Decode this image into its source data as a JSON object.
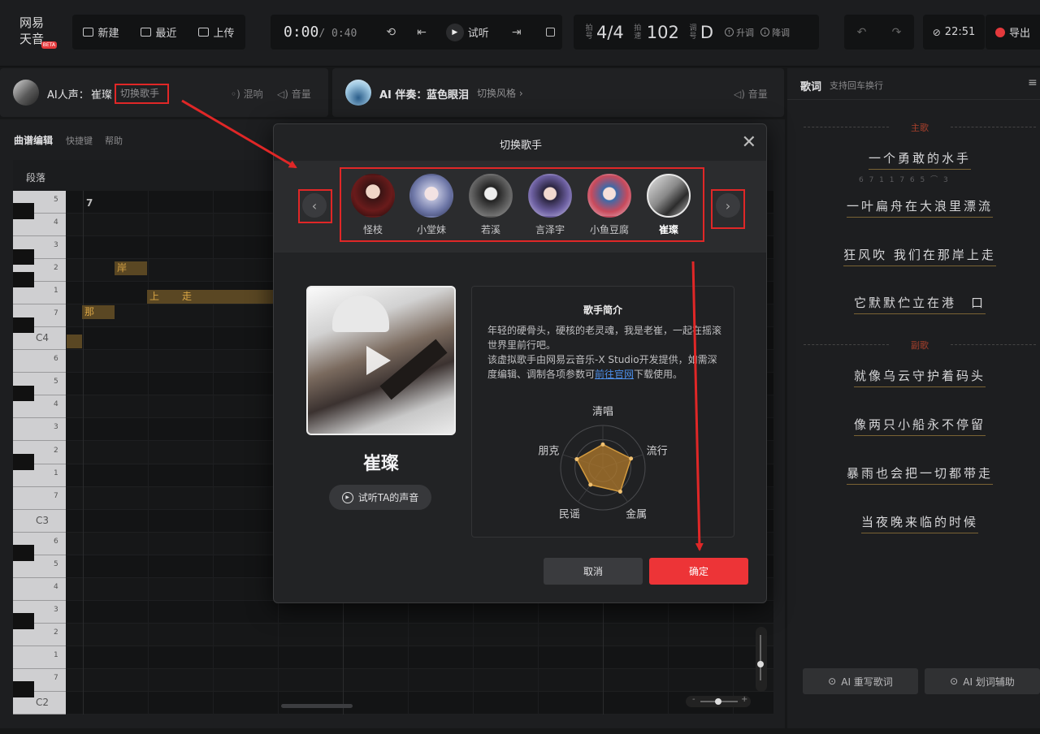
{
  "app": {
    "logo_text": "网易天音",
    "beta": "BETA"
  },
  "toolbar": {
    "new": "新建",
    "recent": "最近",
    "upload": "上传",
    "time_current": "0:00",
    "time_total": "/ 0:40",
    "preview": "试听",
    "meter_beat_label": "拍号",
    "beat": "4/4",
    "meter_tempo_label": "拍速",
    "tempo": "102",
    "meter_key_label": "调号",
    "key": "D",
    "key_up": "升调",
    "key_down": "降调",
    "clock": "22:51",
    "export": "导出"
  },
  "vocal": {
    "label": "AI人声：",
    "singer": "崔璨",
    "switch": "切换歌手",
    "reverb": "混响",
    "volume": "音量"
  },
  "accomp": {
    "label": "AI 伴奏：",
    "style": "蓝色眼泪",
    "switch": "切换风格",
    "volume": "音量"
  },
  "editor": {
    "title": "曲谱编辑",
    "shortcuts": "快捷键",
    "help": "帮助",
    "section": "段落",
    "bar_number": "7",
    "notes": [
      "岸",
      "上",
      "走",
      "那"
    ]
  },
  "piano_labels": [
    "5",
    "4",
    "3",
    "2",
    "1",
    "7",
    "C4",
    "6",
    "5",
    "4",
    "3",
    "2",
    "1",
    "7",
    "C3",
    "6",
    "5",
    "4",
    "3",
    "2",
    "1",
    "7",
    "C2"
  ],
  "lyrics": {
    "title": "歌词",
    "hint": "支持回车换行",
    "section_verse": "主歌",
    "section_chorus": "副歌",
    "notation": "6 7 1 1 7 6 5 ⌒ 3",
    "lines": [
      "一个勇敢的水手",
      "一叶扁舟在大浪里漂流",
      "狂风吹 我们在那岸上走",
      "它默默伫立在港　口",
      "就像乌云守护着码头",
      "像两只小船永不停留",
      "暴雨也会把一切都带走",
      "当夜晚来临的时候"
    ],
    "rewrite": "AI 重写歌词",
    "assist": "AI 划词辅助"
  },
  "modal": {
    "title": "切换歌手",
    "singers": [
      "怪枝",
      "小堂妹",
      "若溪",
      "言泽宇",
      "小鱼豆腐",
      "崔璨"
    ],
    "selected_name": "崔璨",
    "listen": "试听TA的声音",
    "intro_title": "歌手简介",
    "intro_p1": "年轻的硬骨头，硬核的老灵魂，我是老崔，一起在摇滚世界里前行吧。",
    "intro_p2_a": "该虚拟歌手由网易云音乐-X Studio开发提供，如需深度编辑、调制各项参数可",
    "intro_link": "前往官网",
    "intro_p2_b": "下载使用。",
    "radar_labels": [
      "清唱",
      "流行",
      "金属",
      "民谣",
      "朋克"
    ],
    "radar_values": [
      0.55,
      0.7,
      0.7,
      0.5,
      0.65
    ],
    "cancel": "取消",
    "ok": "确定"
  }
}
